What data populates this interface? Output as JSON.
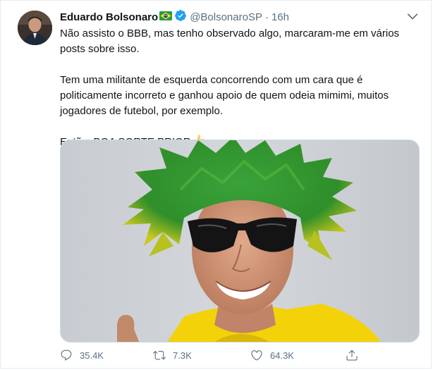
{
  "tweet": {
    "author_name": "Eduardo Bolsonaro",
    "handle": "@BolsonaroSP",
    "separator": "·",
    "time": "16h",
    "paragraphs": [
      "Não assisto o BBB, mas tenho observado algo, marcaram-me em vários posts sobre isso.",
      "Tem uma militante de esquerda concorrendo com um cara que é politicamente incorreto e ganhou apoio de quem odeia mimimi, muitos jogadores de futebol, por exemplo.",
      "Então, BOA SORTE PRIOR"
    ],
    "icons": {
      "flag": "brazil-flag-icon",
      "verified": "verified-badge-icon",
      "caret": "chevron-down-icon",
      "thumbs": "thumbs-up-emoji-icon"
    }
  },
  "actions": {
    "reply_count": "35.4K",
    "retweet_count": "7.3K",
    "like_count": "64.3K",
    "share_icon": "share-icon"
  },
  "colors": {
    "text_primary": "#0f1419",
    "text_secondary": "#5b7083",
    "verified_blue": "#1da1f2",
    "border": "#e6ecf0"
  }
}
